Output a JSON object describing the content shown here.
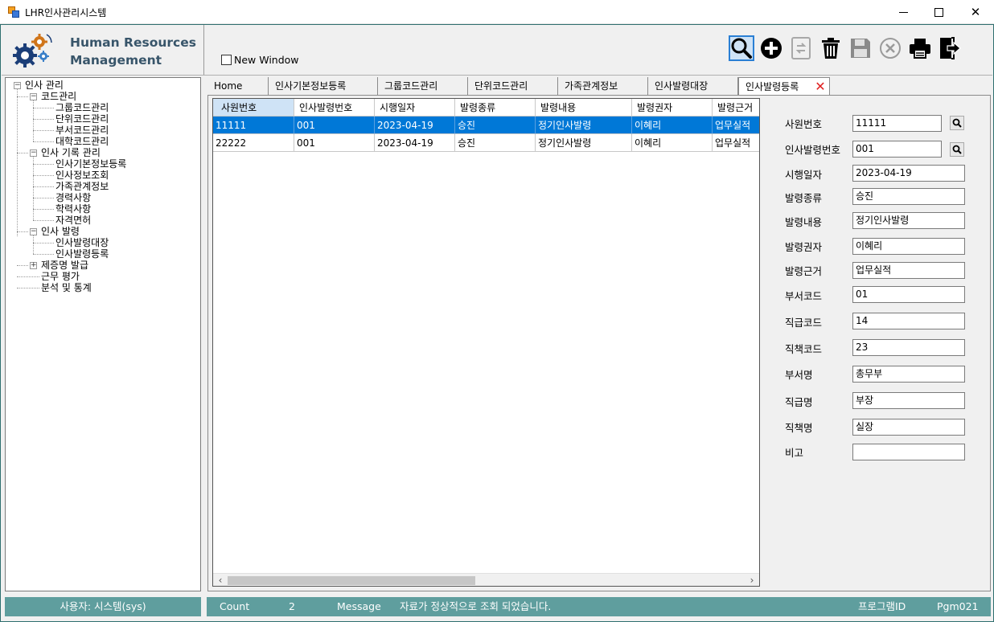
{
  "window": {
    "title": "LHR인사관리시스템"
  },
  "logo": {
    "line1": "Human Resources",
    "line2": "Management",
    "icon": "gears-icon"
  },
  "new_window": {
    "label": "New Window",
    "checked": false
  },
  "toolbar": [
    {
      "name": "search",
      "icon": "magnifier-icon",
      "selected": true
    },
    {
      "name": "add",
      "icon": "plus-circle-icon"
    },
    {
      "name": "convert",
      "icon": "swap-icon",
      "disabled": true
    },
    {
      "name": "delete",
      "icon": "trash-icon"
    },
    {
      "name": "save",
      "icon": "floppy-icon",
      "disabled": true
    },
    {
      "name": "cancel",
      "icon": "x-circle-icon",
      "disabled": true
    },
    {
      "name": "print",
      "icon": "printer-icon"
    },
    {
      "name": "exit",
      "icon": "exit-door-icon"
    }
  ],
  "tree": {
    "root": "인사 관리",
    "groups": [
      {
        "label": "코드관리",
        "items": [
          "그룹코드관리",
          "단위코드관리",
          "부서코드관리",
          "대학코드관리"
        ]
      },
      {
        "label": "인사 기록 관리",
        "items": [
          "인사기본정보등록",
          "인사정보조회",
          "가족관계정보",
          "경력사항",
          "학력사항",
          "자격면허"
        ]
      },
      {
        "label": "인사 발령",
        "items": [
          "인사발령대장",
          "인사발령등록"
        ]
      },
      {
        "label": "제증명 발급",
        "items": []
      }
    ],
    "leaves": [
      "근무 평가",
      "분석 및 통계"
    ]
  },
  "tabs": [
    "Home",
    "인사기본정보등록",
    "그룹코드관리",
    "단위코드관리",
    "가족관계정보",
    "인사발령대장",
    "인사발령등록"
  ],
  "grid": {
    "columns": [
      "사원번호",
      "인사발령번호",
      "시행일자",
      "발령종류",
      "발령내용",
      "발령권자",
      "발령근거"
    ],
    "rows": [
      [
        "11111",
        "001",
        "2023-04-19",
        "승진",
        "정기인사발령",
        "이혜리",
        "업무실적"
      ],
      [
        "22222",
        "001",
        "2023-04-19",
        "승진",
        "정기인사발령",
        "이혜리",
        "업무실적"
      ]
    ],
    "selected_row": 0
  },
  "form": [
    {
      "label": "사원번호",
      "value": "11111",
      "search": true
    },
    {
      "label": "인사발령번호",
      "value": "001",
      "search": true
    },
    {
      "label": "시행일자",
      "value": "2023-04-19"
    },
    {
      "label": "발령종류",
      "value": "승진"
    },
    {
      "label": "발령내용",
      "value": "정기인사발령"
    },
    {
      "label": "발령권자",
      "value": "이혜리"
    },
    {
      "label": "발령근거",
      "value": "업무실적"
    },
    {
      "label": "부서코드",
      "value": "01"
    },
    {
      "label": "직급코드",
      "value": "14"
    },
    {
      "label": "직책코드",
      "value": "23"
    },
    {
      "label": "부서명",
      "value": "총무부"
    },
    {
      "label": "직급명",
      "value": "부장"
    },
    {
      "label": "직책명",
      "value": "실장"
    },
    {
      "label": "비고",
      "value": ""
    }
  ],
  "status": {
    "user": "사용자: 시스템(sys)",
    "count_label": "Count",
    "count": "2",
    "message_label": "Message",
    "message": "자료가 정상적으로 조회 되었습니다.",
    "program_label": "프로그램ID",
    "program_id": "Pgm021"
  },
  "colors": {
    "accent": "#5f9e9e",
    "selection": "#0078d7",
    "logo_text": "#38556a"
  }
}
